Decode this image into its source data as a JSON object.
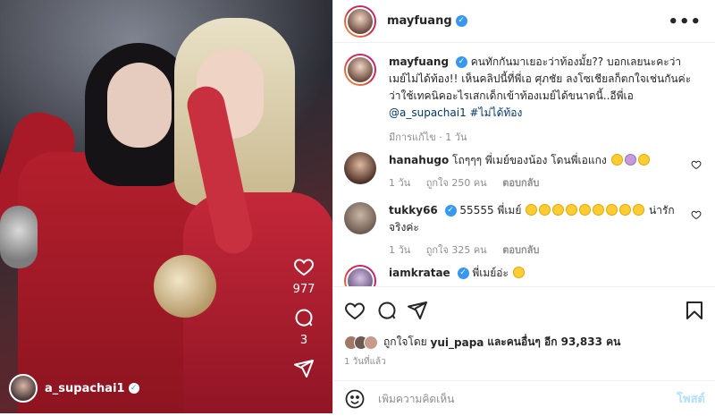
{
  "video": {
    "like_count": "977",
    "comment_count": "3",
    "owner_username": "a_supachai1"
  },
  "header": {
    "username": "mayfuang",
    "more_icon": "more-horizontal-icon"
  },
  "caption": {
    "username": "mayfuang",
    "text": "คนทักกันมาเยอะว่าท้องมั้ย?? บอกเลยนะคะว่าเมย์ไม่ได้ท้อง!! เห็นคลิปนี้ที่พี่เอ ศุภชัย ลงโซเชียลก็ตกใจเช่นกันค่ะ ว่าใช้เทคนิคอะไรเสกเด็กเข้าท้องเมย์ได้ขนาดนี้..อีพี่เอ ",
    "mention": "@a_supachai1",
    "hashtag": "#ไม่ได้ท้อง",
    "meta": "มีการแก้ไข · 1 วัน"
  },
  "comments": [
    {
      "username": "hanahugo",
      "text": "โถๆๆๆ พี่เมย์ของน้อง โดนพี่เอแกง",
      "time": "1 วัน",
      "likes": "ถูกใจ 250 คน",
      "reply": "ตอบกลับ"
    },
    {
      "username": "tukky66",
      "text": "55555 พี่เมย์",
      "text_tail": "น่ารักจริงค่ะ",
      "time": "1 วัน",
      "likes": "ถูกใจ 325 คน",
      "reply": "ตอบกลับ"
    },
    {
      "username": "iamkratae",
      "text": "พี่เมย์อ่ะ"
    }
  ],
  "actions": {
    "liked_by_prefix": "ถูกใจโดย",
    "liked_by_user": "yui_papa",
    "liked_by_others": "และคนอื่นๆ อีก 93,833 คน",
    "posted_time": "1 วันที่แล้ว"
  },
  "add_comment": {
    "placeholder": "เพิ่มความคิดเห็น",
    "post_label": "โพสต์"
  },
  "colors": {
    "verified": "#3897f0",
    "link": "#00376b",
    "muted": "#8e8e8e",
    "post_disabled": "#b2dffc"
  }
}
